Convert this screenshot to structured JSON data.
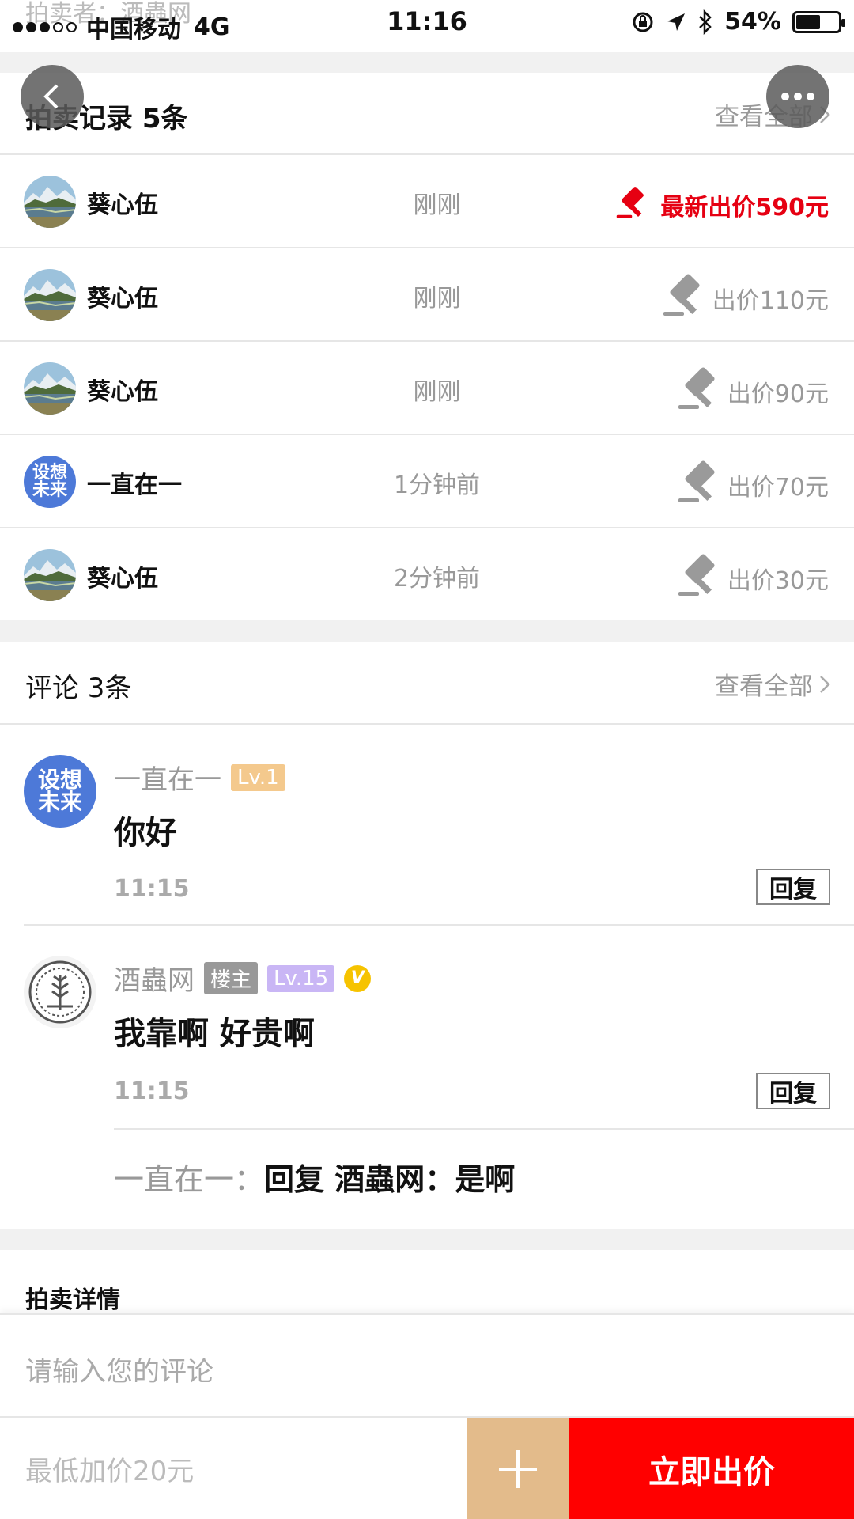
{
  "status_bar": {
    "carrier": "中国移动",
    "network": "4G",
    "time": "11:16",
    "battery": "54%",
    "battery_level": 0.54,
    "ghost_seller": "拍卖者：酒蟲网"
  },
  "auction_records": {
    "title": "拍卖记录 5条",
    "view_all": "查看全部",
    "rows": [
      {
        "name": "葵心伍",
        "avatar": "landscape-avatar",
        "time": "刚刚",
        "bid": "最新出价590元",
        "latest": true
      },
      {
        "name": "葵心伍",
        "avatar": "landscape-avatar",
        "time": "刚刚",
        "bid": "出价110元",
        "latest": false
      },
      {
        "name": "葵心伍",
        "avatar": "landscape-avatar",
        "time": "刚刚",
        "bid": "出价90元",
        "latest": false
      },
      {
        "name": "一直在一",
        "avatar": "text-avatar",
        "avatar_text": "设想未来",
        "time": "1分钟前",
        "bid": "出价70元",
        "latest": false
      },
      {
        "name": "葵心伍",
        "avatar": "landscape-avatar",
        "time": "2分钟前",
        "bid": "出价30元",
        "latest": false
      }
    ]
  },
  "comments": {
    "title": "评论 3条",
    "view_all": "查看全部",
    "items": [
      {
        "name": "一直在一",
        "level": "Lv.1",
        "avatar_text": "设想未来",
        "text": "你好",
        "time": "11:15",
        "reply": "回复"
      },
      {
        "name": "酒蟲网",
        "owner_badge": "楼主",
        "level": "Lv.15",
        "verified": "V",
        "text": "我靠啊 好贵啊",
        "time": "11:15",
        "reply": "回复",
        "sub_reply": {
          "author": "一直在一：",
          "content": "回复 酒蟲网：是啊"
        }
      }
    ]
  },
  "details": {
    "title": "拍卖详情"
  },
  "input": {
    "placeholder": "请输入您的评论"
  },
  "bottom_bar": {
    "min_increment": "最低加价20元",
    "plus_label": "+",
    "bid_button": "立即出价"
  },
  "colors": {
    "accent_red": "#ff0000",
    "bid_red": "#e60012",
    "plus_bg": "#e3bb8b",
    "level1": "#f4c98d",
    "level15": "#c9b6f5",
    "verified": "#f6c300"
  }
}
